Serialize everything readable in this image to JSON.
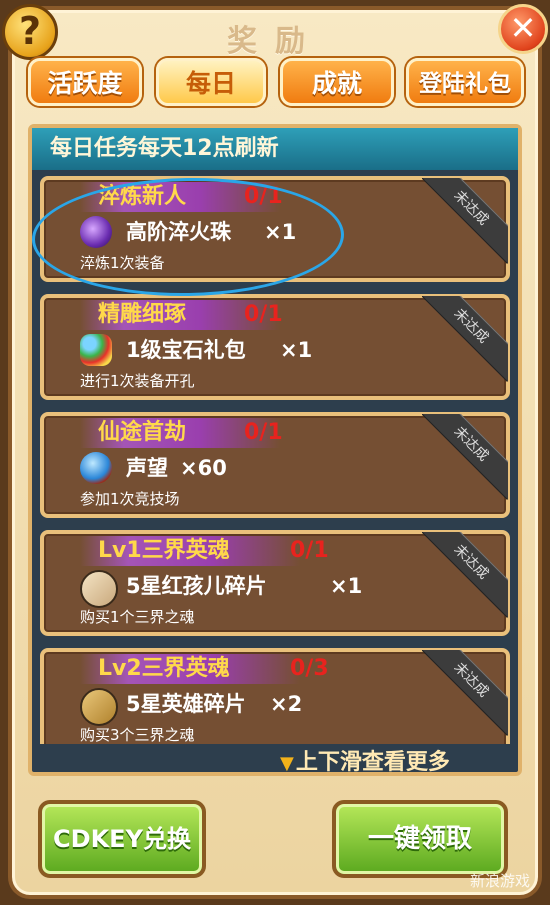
{
  "window": {
    "title": "奖励"
  },
  "tabs": [
    {
      "label": "活跃度"
    },
    {
      "label": "每日"
    },
    {
      "label": "成就"
    },
    {
      "label": "登陆礼包"
    }
  ],
  "panel": {
    "header": "每日任务每天12点刷新"
  },
  "quests": [
    {
      "name": "淬炼新人",
      "progress": "0/1",
      "item": "高阶淬火珠",
      "qty": "×1",
      "desc": "淬炼1次装备",
      "status": "未达成",
      "icon": "purple-orb-icon"
    },
    {
      "name": "精雕细琢",
      "progress": "0/1",
      "item": "1级宝石礼包",
      "qty": "×1",
      "desc": "进行1次装备开孔",
      "status": "未达成",
      "icon": "gem-pack-icon"
    },
    {
      "name": "仙途首劫",
      "progress": "0/1",
      "item": "声望",
      "qty": "×60",
      "desc": "参加1次竞技场",
      "status": "未达成",
      "icon": "reputation-orb-icon"
    },
    {
      "name": "Lv1三界英魂",
      "progress": "0/1",
      "item": "5星红孩儿碎片",
      "qty": "×1",
      "desc": "购买1个三界之魂",
      "status": "未达成",
      "icon": "hero-shard-icon"
    },
    {
      "name": "Lv2三界英魂",
      "progress": "0/3",
      "item": "5星英雄碎片",
      "qty": "×2",
      "desc": "购买3个三界之魂",
      "status": "未达成",
      "icon": "puzzle-shard-icon"
    }
  ],
  "scroll_hint": "上下滑查看更多",
  "buttons": {
    "cdkey": "CDKEY兑换",
    "claim_all": "一键领取"
  },
  "watermark": "新浪游戏",
  "colors": {
    "tab": "#f07c10",
    "progress": "#e8231e",
    "quest_name": "#ffd94a",
    "button": "#5aa81e"
  }
}
